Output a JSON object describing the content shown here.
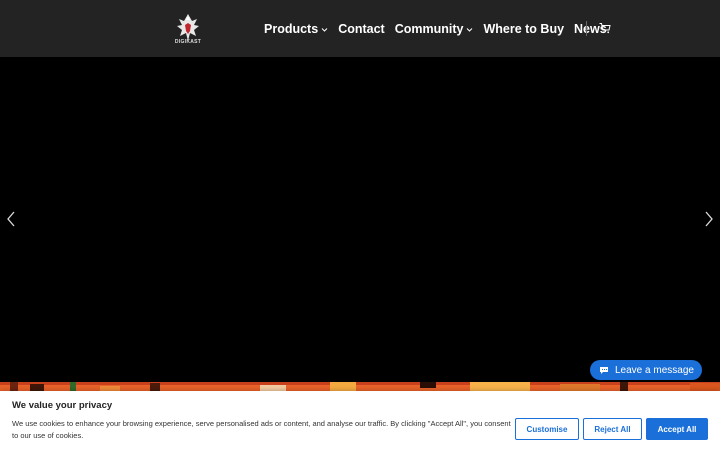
{
  "brand": {
    "logo_text": "DIGIKAST",
    "accent": "#c0272d"
  },
  "nav": {
    "items": [
      {
        "label": "Products",
        "has_dropdown": true
      },
      {
        "label": "Contact",
        "has_dropdown": false
      },
      {
        "label": "Community",
        "has_dropdown": true
      },
      {
        "label": "Where to Buy",
        "has_dropdown": false
      },
      {
        "label": "News",
        "has_dropdown": false
      }
    ],
    "cart_icon": "cart-icon"
  },
  "hero": {
    "prev_icon": "chevron-left-icon",
    "next_icon": "chevron-right-icon",
    "background": "#000000"
  },
  "chat": {
    "label": "Leave a message",
    "icon": "chat-bubble-icon",
    "color": "#1a6fd8"
  },
  "cookie": {
    "title": "We value your privacy",
    "text": "We use cookies to enhance your browsing experience, serve personalised ads or content, and analyse our traffic. By clicking \"Accept All\", you consent to our use of cookies.",
    "customise_label": "Customise",
    "reject_label": "Reject All",
    "accept_label": "Accept All",
    "button_color": "#1a6fd8"
  }
}
